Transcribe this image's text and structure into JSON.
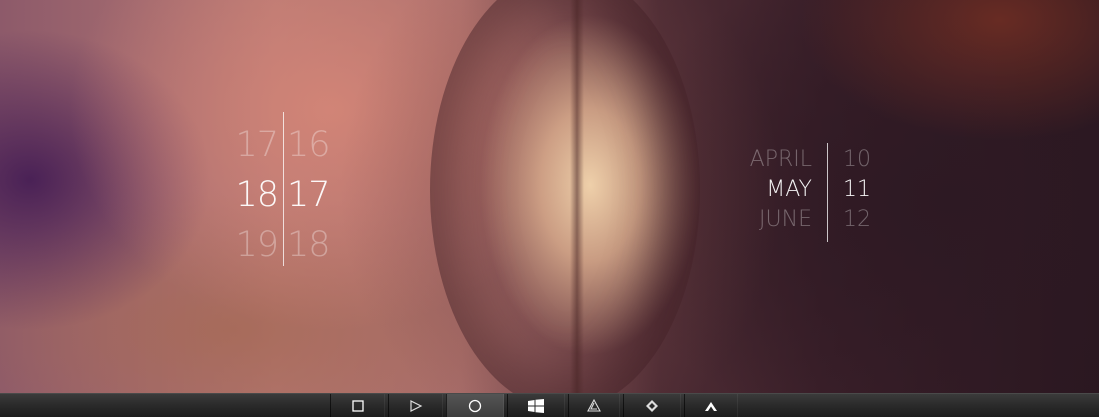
{
  "time_widget": {
    "hours": [
      "17",
      "18",
      "19"
    ],
    "minutes": [
      "16",
      "17",
      "18"
    ]
  },
  "date_widget": {
    "months": [
      "APRIL",
      "MAY",
      "JUNE"
    ],
    "days": [
      "10",
      "11",
      "12"
    ]
  },
  "taskbar": {
    "buttons": [
      {
        "icon": "square-icon"
      },
      {
        "icon": "play-triangle-icon"
      },
      {
        "icon": "circle-icon"
      },
      {
        "icon": "windows-logo-icon"
      },
      {
        "icon": "delta-triangle-icon"
      },
      {
        "icon": "diamond-icon"
      },
      {
        "icon": "chevron-up-icon"
      }
    ]
  }
}
